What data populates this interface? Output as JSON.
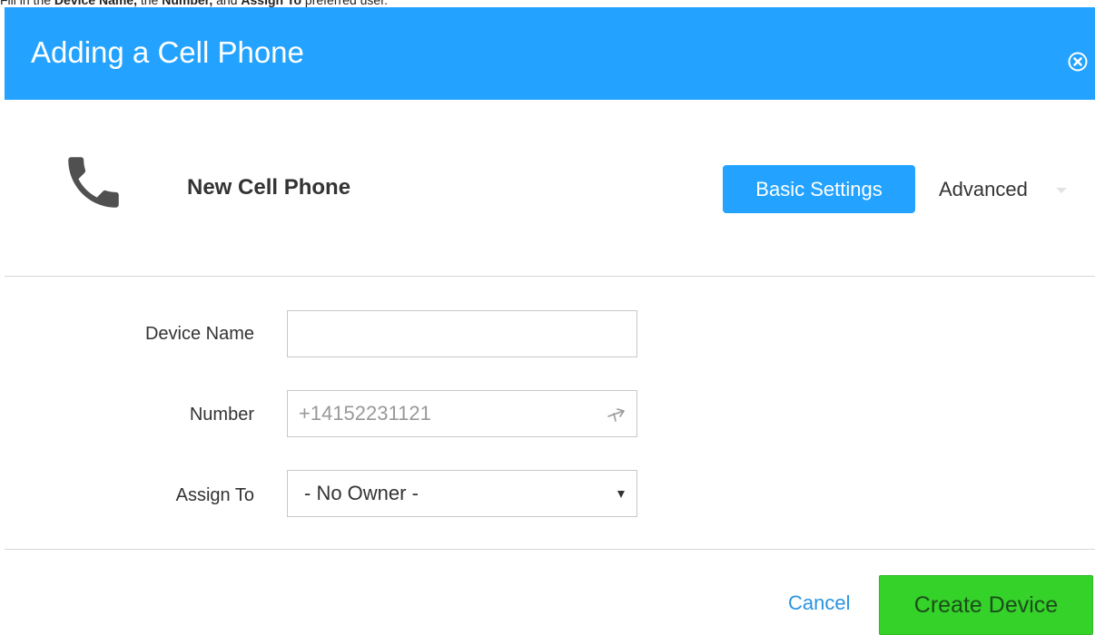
{
  "instruction": {
    "prefix": "Fill in the ",
    "field1": "Device Name,",
    "mid1": " the ",
    "field2": "Number,",
    "mid2": " and ",
    "field3": "Assign To",
    "suffix": " preferred user."
  },
  "header": {
    "title": "Adding a Cell Phone",
    "close_icon": "close-circle-icon",
    "background_color": "#23a3ff"
  },
  "device": {
    "icon": "phone-icon",
    "title": "New Cell Phone"
  },
  "tabs": {
    "basic_label": "Basic Settings",
    "advanced_label": "Advanced",
    "active": "Basic Settings"
  },
  "form": {
    "device_name": {
      "label": "Device Name",
      "value": "",
      "placeholder": ""
    },
    "number": {
      "label": "Number",
      "value": "+14152231121",
      "icon": "phone-forward-icon"
    },
    "assign_to": {
      "label": "Assign To",
      "selected": "- No Owner -"
    }
  },
  "footer": {
    "cancel_label": "Cancel",
    "create_label": "Create Device",
    "create_color": "#35d22a"
  }
}
